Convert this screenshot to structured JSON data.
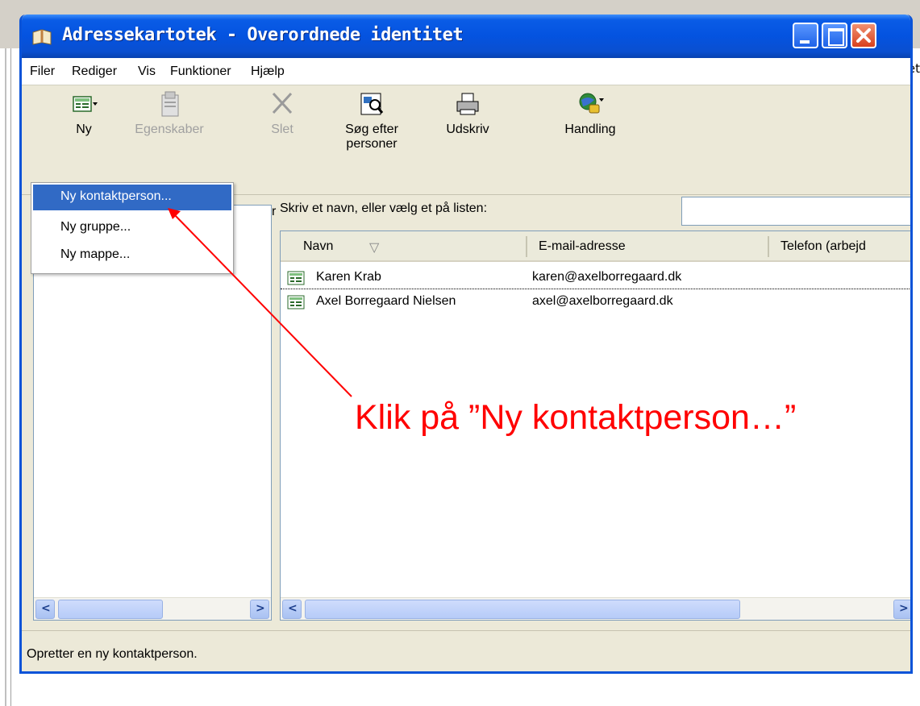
{
  "window": {
    "title": "Adressekartotek - Overordnede identitet"
  },
  "background": {
    "right_peek_text": "et"
  },
  "menu": [
    "Filer",
    "Rediger",
    "Vis",
    "Funktioner",
    "Hjælp"
  ],
  "toolbar": {
    "new": "Ny",
    "properties": "Egenskaber",
    "delete": "Slet",
    "find_line1": "Søg efter",
    "find_line2": "personer",
    "print": "Udskriv",
    "action": "Handling"
  },
  "dropdown": {
    "items": [
      "Ny kontaktperson...",
      "Ny gruppe...",
      "Ny mappe..."
    ],
    "highlighted_index": 0
  },
  "search": {
    "label": "Skriv et navn, eller vælg et på listen:",
    "value": ""
  },
  "table": {
    "columns": [
      "Navn",
      "E-mail-adresse",
      "Telefon (arbejd"
    ],
    "sort_indicator": "▽",
    "rows": [
      {
        "name": "Karen Krab",
        "email": "karen@axelborregaard.dk",
        "phone": ""
      },
      {
        "name": "Axel Borregaard Nielsen",
        "email": "axel@axelborregaard.dk",
        "phone": ""
      }
    ]
  },
  "left_pane": {
    "peek_text_1": "r",
    "peek_text_2": "'"
  },
  "status": {
    "text": "Opretter en ny kontaktperson."
  },
  "annotation": {
    "text": "Klik på ”Ny kontaktperson…”",
    "color": "#ff0000"
  },
  "colors": {
    "titlebar": "#0453e0",
    "highlight": "#316ac5",
    "face": "#ece9d8"
  }
}
